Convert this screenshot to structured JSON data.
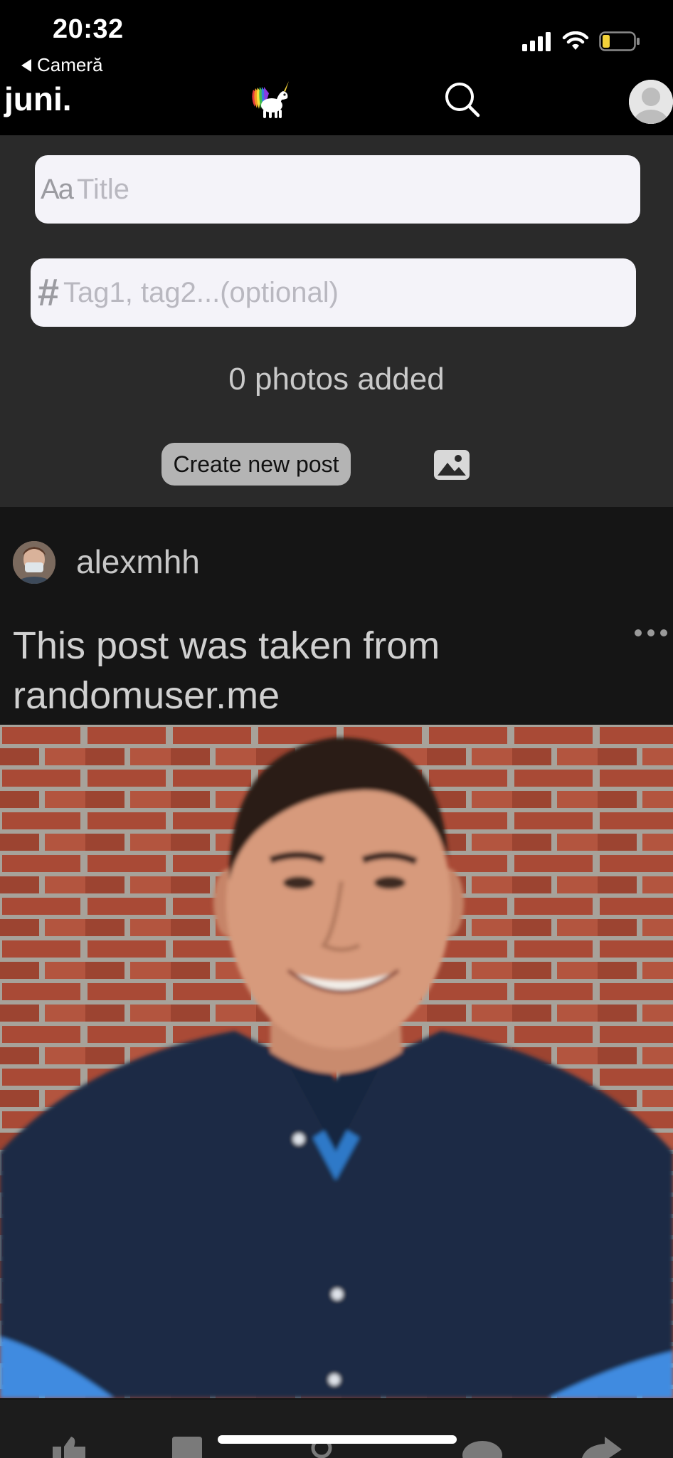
{
  "status_bar": {
    "time": "20:32",
    "back_app": "Cameră",
    "icons": [
      "signal-icon",
      "wifi-icon",
      "battery-icon"
    ]
  },
  "header": {
    "brand": "juni.",
    "logo_icon": "unicorn-icon",
    "search_icon": "search-icon",
    "profile_icon": "avatar-icon"
  },
  "composer": {
    "title_prefix": "Aa",
    "title_placeholder": "Title",
    "tags_prefix": "#",
    "tags_placeholder": "Tag1, tag2...(optional)",
    "photos_count": "0 photos added",
    "create_button": "Create new post",
    "image_icon": "image-icon"
  },
  "post": {
    "username": "alexmhh",
    "title": "This post was taken from randomuser.me",
    "more_icon": "more-icon",
    "photo": "portrait-photo"
  },
  "action_bar": {
    "icons": [
      "like-icon",
      "bookmark-icon",
      "pin-icon",
      "comment-icon",
      "share-icon"
    ]
  },
  "colors": {
    "composer_bg": "#2a2a2a",
    "post_bg": "#151515",
    "input_bg": "#f4f3f9",
    "button_bg": "#b4b4b4"
  }
}
